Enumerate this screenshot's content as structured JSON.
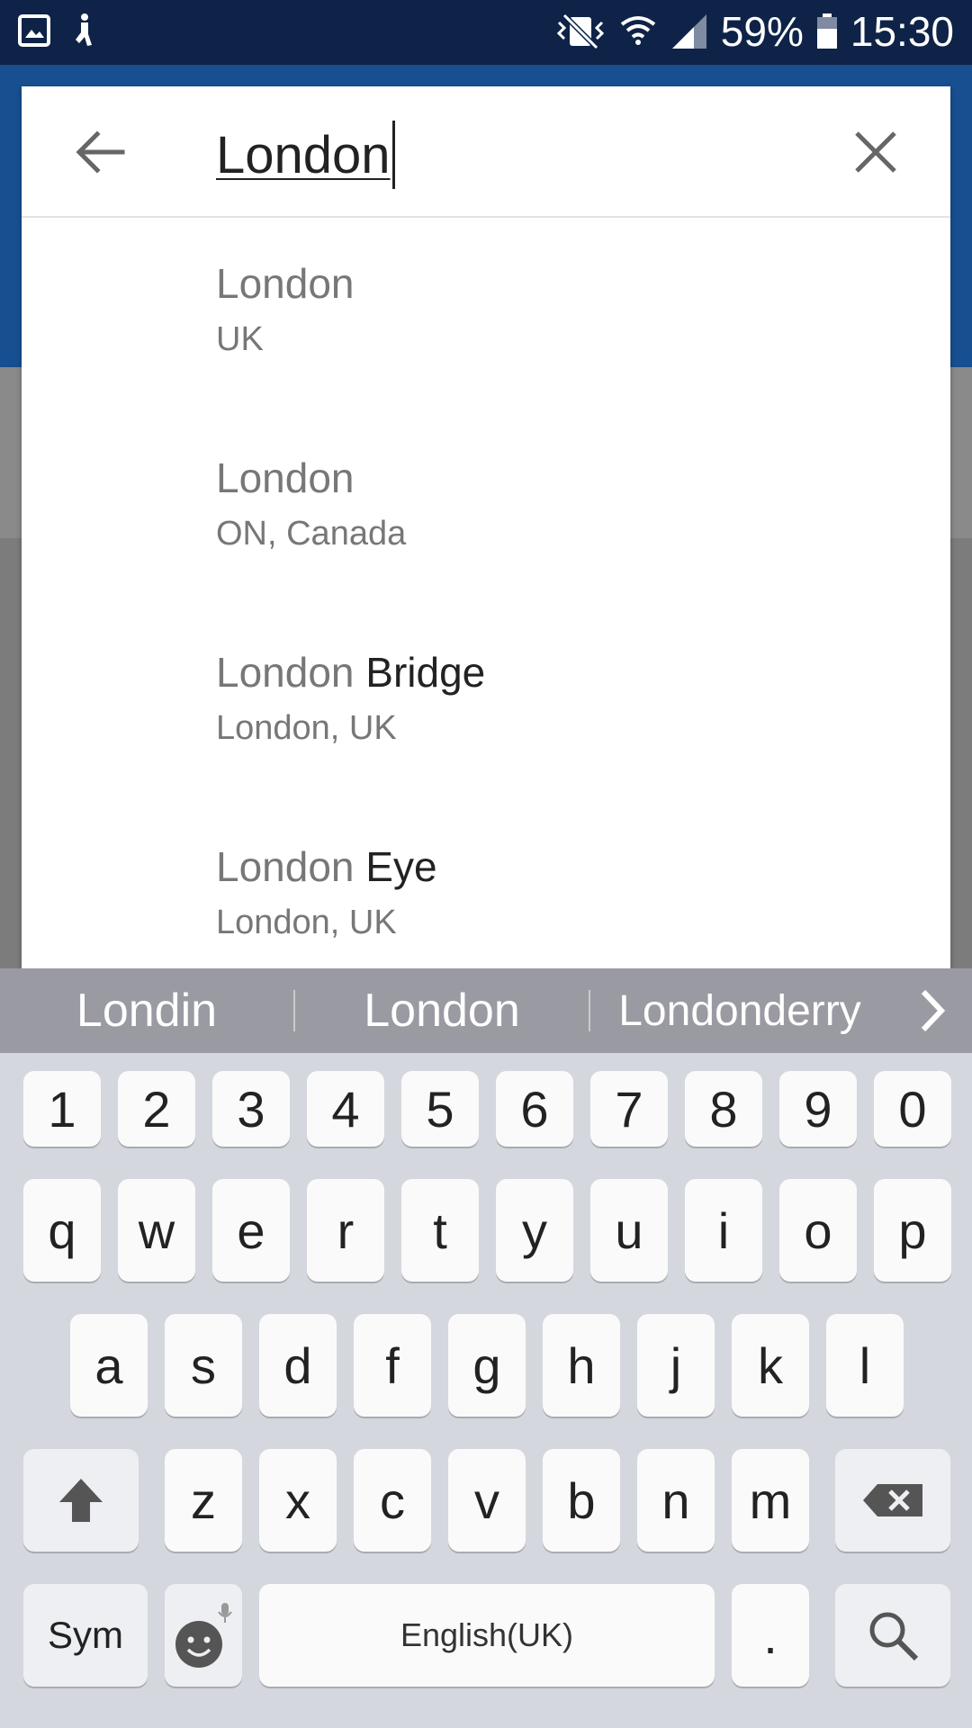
{
  "status_bar": {
    "battery": "59%",
    "time": "15:30"
  },
  "search": {
    "query": "London"
  },
  "results": [
    {
      "match": "London",
      "rest": "",
      "subtitle": "UK"
    },
    {
      "match": "London",
      "rest": "",
      "subtitle": "ON, Canada"
    },
    {
      "match": "London",
      "rest": " Bridge",
      "subtitle": "London, UK"
    },
    {
      "match": "London",
      "rest": " Eye",
      "subtitle": "London, UK"
    }
  ],
  "suggestions": [
    "Londin",
    "London",
    "Londonderry"
  ],
  "keyboard": {
    "number_row": [
      "1",
      "2",
      "3",
      "4",
      "5",
      "6",
      "7",
      "8",
      "9",
      "0"
    ],
    "row1": [
      "q",
      "w",
      "e",
      "r",
      "t",
      "y",
      "u",
      "i",
      "o",
      "p"
    ],
    "row2": [
      "a",
      "s",
      "d",
      "f",
      "g",
      "h",
      "j",
      "k",
      "l"
    ],
    "row3": [
      "z",
      "x",
      "c",
      "v",
      "b",
      "n",
      "m"
    ],
    "sym_label": "Sym",
    "space_label": "English(UK)",
    "period_label": "."
  }
}
